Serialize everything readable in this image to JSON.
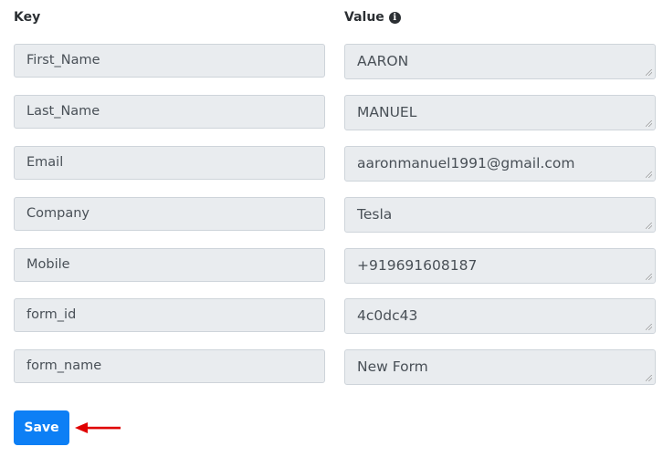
{
  "headers": {
    "key": "Key",
    "value": "Value",
    "value_info_icon": "info-circle-icon"
  },
  "rows": [
    {
      "key": "First_Name",
      "value": "AARON"
    },
    {
      "key": "Last_Name",
      "value": "MANUEL"
    },
    {
      "key": "Email",
      "value": "aaronmanuel1991@gmail.com"
    },
    {
      "key": "Company",
      "value": "Tesla"
    },
    {
      "key": "Mobile",
      "value": "+919691608187"
    },
    {
      "key": "form_id",
      "value": "4c0dc43"
    },
    {
      "key": "form_name",
      "value": "New Form"
    }
  ],
  "save_label": "Save",
  "colors": {
    "accent": "#0d7ff5",
    "field_bg": "#e9ecef",
    "arrow": "#e00000"
  }
}
